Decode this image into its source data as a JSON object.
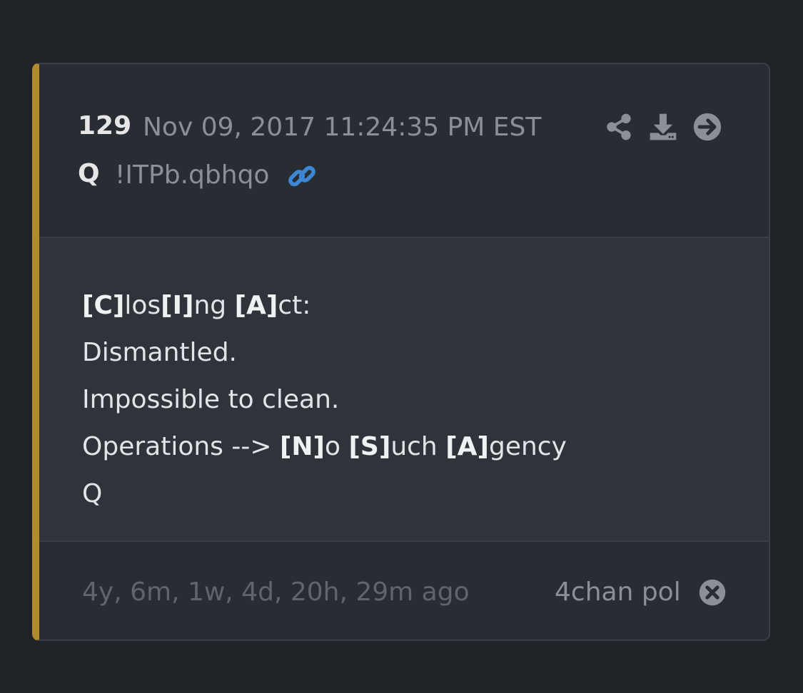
{
  "post": {
    "number": "129",
    "date": "Nov 09, 2017 11:24:35 PM EST",
    "author": "Q",
    "tripcode": "!ITPb.qbhqo",
    "body_lines": [
      [
        {
          "t": "[C]",
          "b": true
        },
        {
          "t": "los"
        },
        {
          "t": "[I]",
          "b": true
        },
        {
          "t": "ng "
        },
        {
          "t": "[A]",
          "b": true
        },
        {
          "t": "ct:"
        }
      ],
      [
        {
          "t": "Dismantled."
        }
      ],
      [
        {
          "t": "Impossible to clean."
        }
      ],
      [
        {
          "t": "Operations --> "
        },
        {
          "t": "[N]",
          "b": true
        },
        {
          "t": "o "
        },
        {
          "t": "[S]",
          "b": true
        },
        {
          "t": "uch "
        },
        {
          "t": "[A]",
          "b": true
        },
        {
          "t": "gency"
        }
      ],
      [
        {
          "t": "Q"
        }
      ]
    ],
    "age": "4y, 6m, 1w, 4d, 20h, 29m ago",
    "source": "4chan pol"
  },
  "icons": {
    "link": "link-icon",
    "share": "share-icon",
    "download": "download-icon",
    "goto": "arrow-right-circle-icon",
    "close": "close-circle-icon"
  },
  "colors": {
    "accent": "#b08d2a",
    "link": "#3d86d4",
    "icon": "#8a8f98"
  }
}
